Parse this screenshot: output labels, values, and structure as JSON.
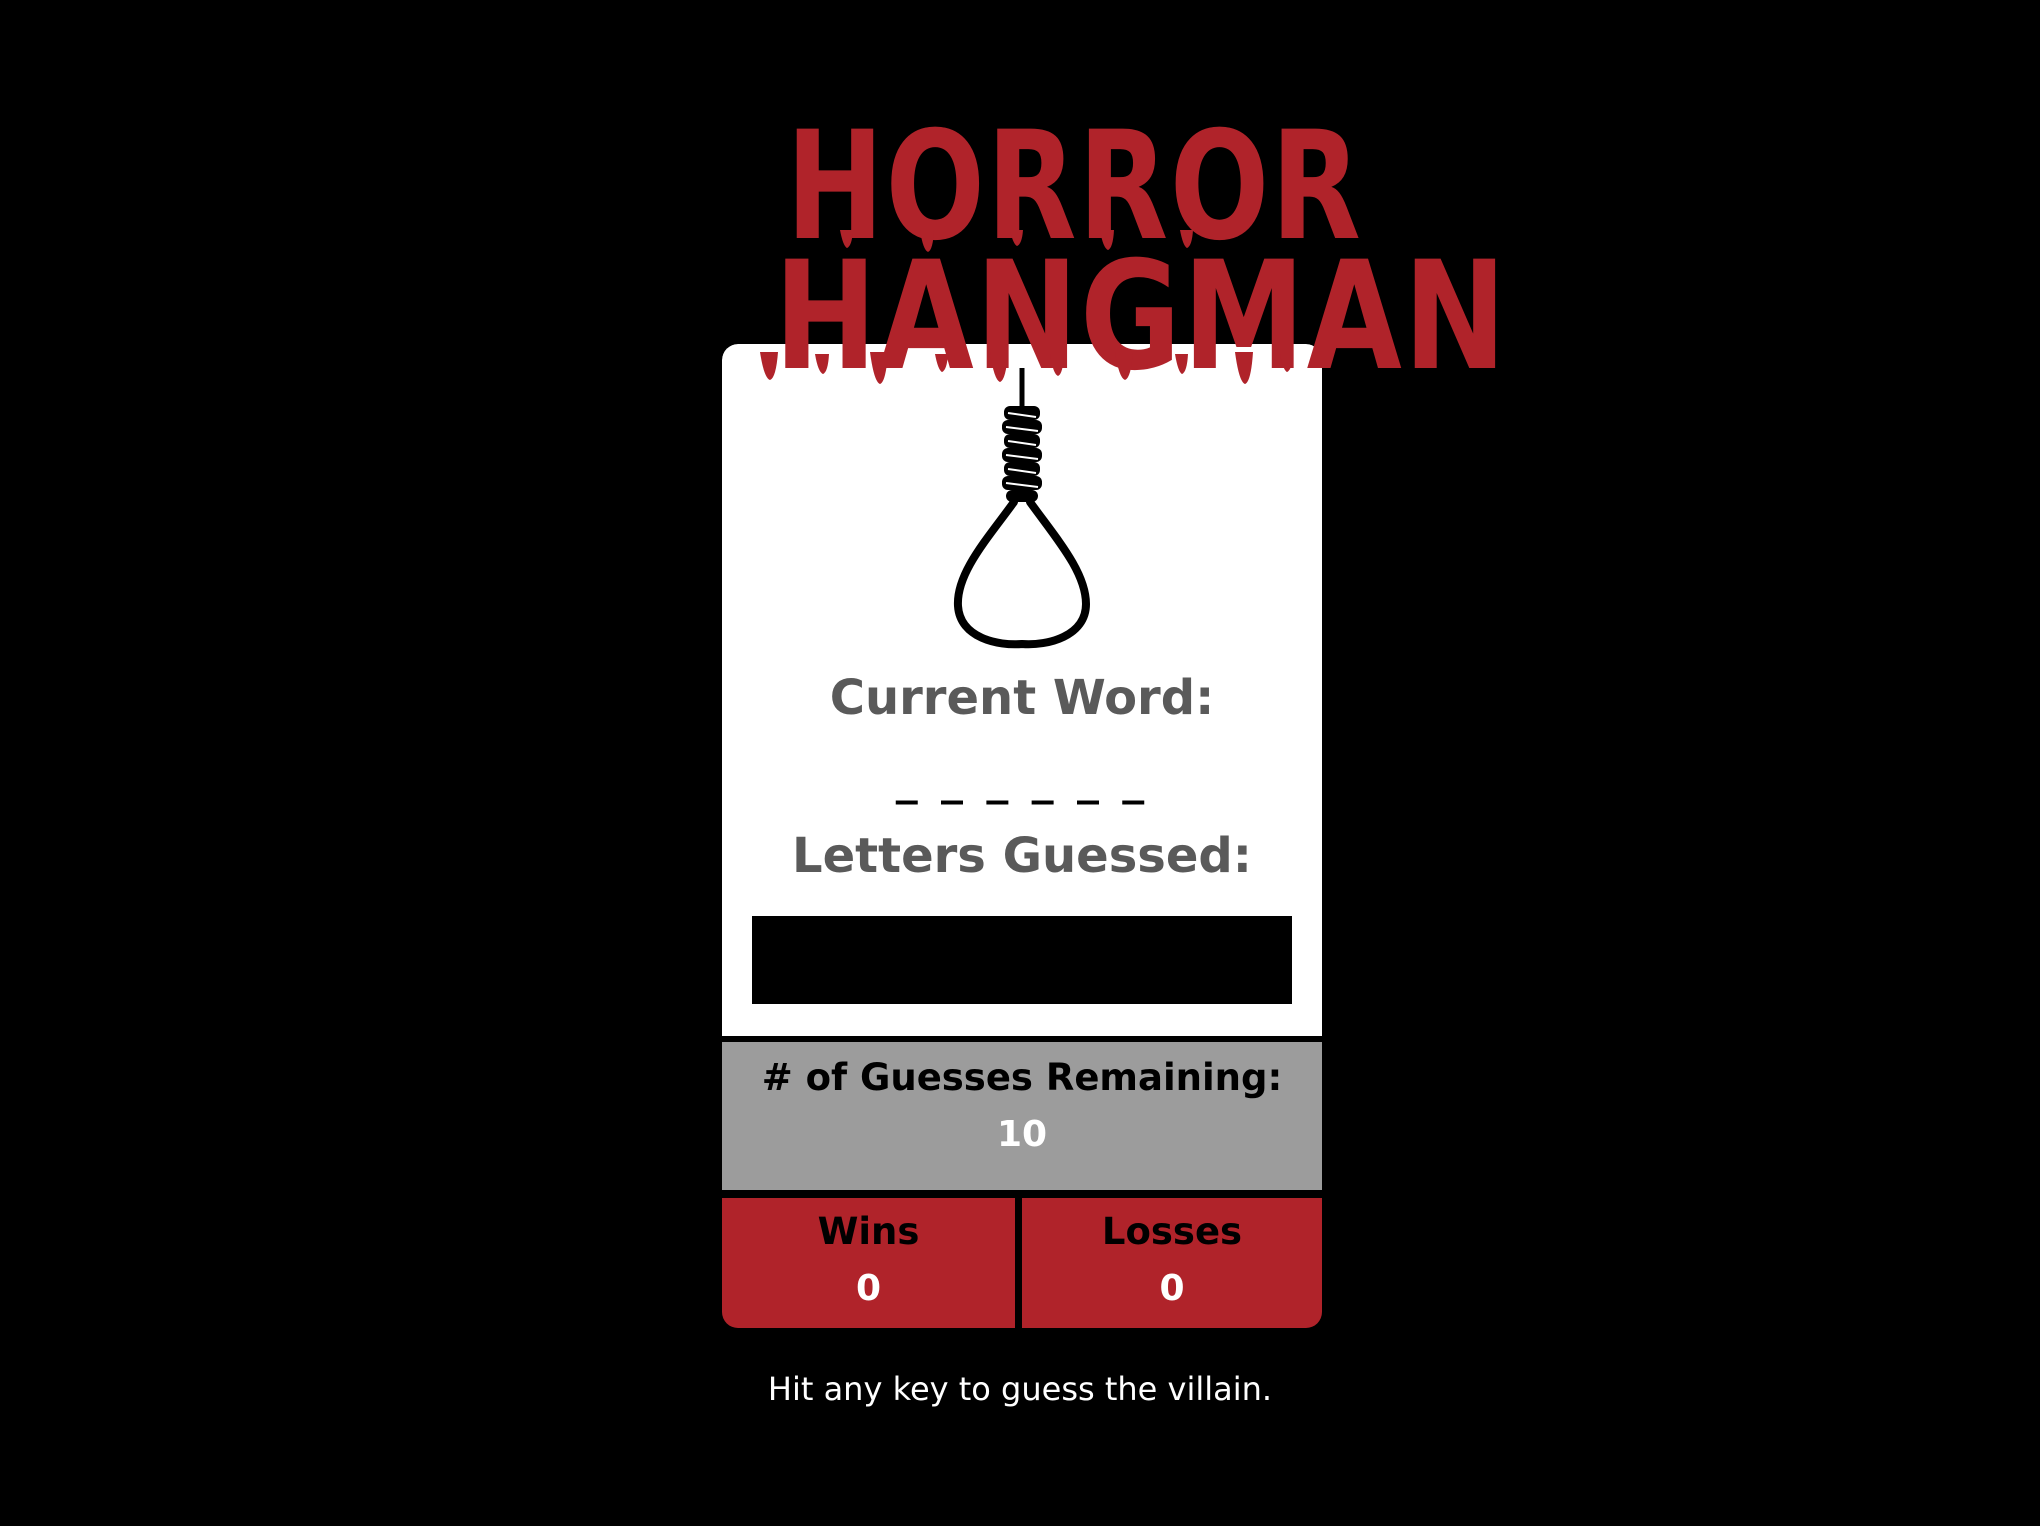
{
  "header": {
    "title_line1": "HORROR",
    "title_line2": "HANGMAN"
  },
  "game": {
    "current_word_label": "Current Word:",
    "current_word": "_ _ _ _ _ _",
    "letters_guessed_label": "Letters Guessed:",
    "letters_guessed": "",
    "guesses_remaining_label": "# of Guesses Remaining:",
    "guesses_remaining": "10"
  },
  "score": {
    "wins_label": "Wins",
    "wins": "0",
    "losses_label": "Losses",
    "losses": "0"
  },
  "footer": {
    "hint": "Hit any key to guess the villain."
  },
  "icons": {
    "noose": "noose-icon"
  },
  "colors": {
    "background": "#000000",
    "blood_red": "#B0232A",
    "card_white": "#FFFFFF",
    "label_gray": "#5A5A5A",
    "remaining_gray": "#9C9C9C"
  }
}
